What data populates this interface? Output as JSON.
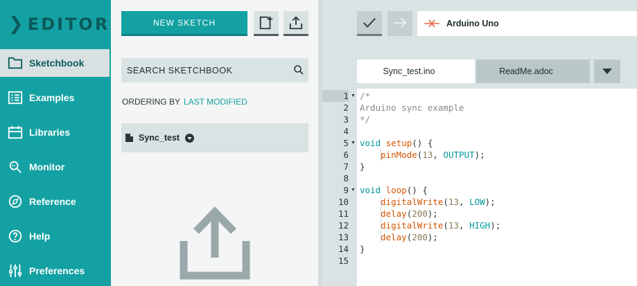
{
  "nav": {
    "logo": "EDITOR",
    "items": [
      {
        "label": "Sketchbook",
        "icon": "folder-icon",
        "active": true
      },
      {
        "label": "Examples",
        "icon": "list-icon"
      },
      {
        "label": "Libraries",
        "icon": "libraries-icon"
      },
      {
        "label": "Monitor",
        "icon": "monitor-icon"
      },
      {
        "label": "Reference",
        "icon": "compass-icon"
      },
      {
        "label": "Help",
        "icon": "help-icon"
      },
      {
        "label": "Preferences",
        "icon": "sliders-icon"
      }
    ]
  },
  "sketchbook": {
    "new_sketch_label": "NEW SKETCH",
    "search_placeholder": "SEARCH SKETCHBOOK",
    "ordering_label": "ORDERING BY",
    "ordering_value": "LAST MODIFIED",
    "sketches": [
      "Sync_test"
    ]
  },
  "editor": {
    "board": "Arduino Uno",
    "tabs": [
      "Sync_test.ino",
      "ReadMe.adoc"
    ],
    "line_numbers": [
      "1",
      "2",
      "3",
      "4",
      "5",
      "6",
      "7",
      "8",
      "9",
      "10",
      "11",
      "12",
      "13",
      "14",
      "15"
    ],
    "code": [
      "/*",
      "Arduino sync example",
      "*/",
      "",
      "void setup() {",
      "    pinMode(13, OUTPUT);",
      "}",
      "",
      "void loop() {",
      "    digitalWrite(13, LOW);",
      "    delay(200);",
      "    digitalWrite(13, HIGH);",
      "    delay(200);",
      "}",
      ""
    ]
  },
  "colors": {
    "accent": "#14a1a3",
    "accent_dark": "#0b5a5b",
    "panel": "#dae3e3"
  }
}
